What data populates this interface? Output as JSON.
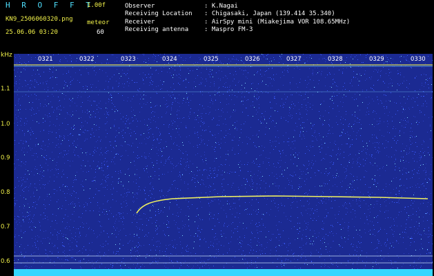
{
  "header": {
    "app_title": "H R O F F T",
    "version": "1.00f",
    "filename": "KN9_2506060320.png",
    "meteor_label": "meteor",
    "datetime": "25.06.06 03:20",
    "meteor_count": "60",
    "info": [
      {
        "label": "Observer",
        "value": ": K.Nagai"
      },
      {
        "label": "Receiving Location",
        "value": ": Chigasaki, Japan (139.414 35.340)"
      },
      {
        "label": "Receiver",
        "value": ": AirSpy mini (Miakejima VOR 108.65MHz)"
      },
      {
        "label": "Receiving antenna",
        "value": ": Maspro FM-3"
      }
    ]
  },
  "axis": {
    "unit": "kHz",
    "y_ticks": [
      "1.1",
      "1.0",
      "0.9",
      "0.8",
      "0.7",
      "0.6"
    ],
    "time_ticks": [
      "0321",
      "0322",
      "0323",
      "0324",
      "0325",
      "0326",
      "0327",
      "0328",
      "0329",
      "0330"
    ]
  },
  "colors": {
    "background": "#1b2a92",
    "noise": "#3a5cff",
    "noise_bright": "#7fd8ff",
    "echo": "#f0f060",
    "label_yellow": "#f2f24a",
    "cyan": "#4fe0ff"
  }
}
